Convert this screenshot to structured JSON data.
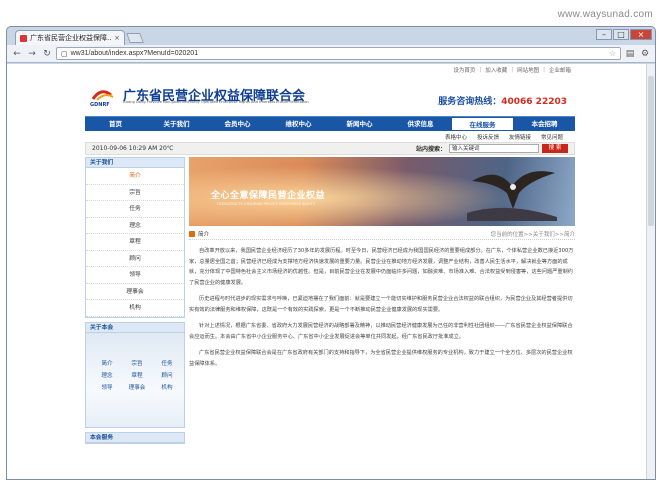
{
  "watermark": "www.waysunad.com",
  "browser": {
    "tab_title": "广东省民营企业权益保障...",
    "address": "ww31/about/index.aspx?MenuId=020201"
  },
  "top_links": [
    "设为首页",
    "加入收藏",
    "网站地图",
    "企业邮箱"
  ],
  "header": {
    "title": "广东省民营企业权益保障联合会",
    "en": "Guang Dong Province Non-governmentally Operated Enterprise Rights And Interests Ensure Federation",
    "hotline_label": "服务咨询热线：",
    "hotline": "40066 22203"
  },
  "nav": [
    "首页",
    "关于我们",
    "会员中心",
    "维权中心",
    "新闻中心",
    "供求信息",
    "在线服务",
    "本会招聘"
  ],
  "subnav": [
    "表格中心",
    "投诉反馈",
    "友情链接",
    "常见问题"
  ],
  "datebar": {
    "date": "2010-09-06 10:29 AM 20℃",
    "search_label": "站内搜索：",
    "search_value": "输入关键词",
    "search_btn": "搜 索"
  },
  "sidebar": {
    "about_title": "关于我们",
    "menu": [
      "简介",
      "宗旨",
      "任务",
      "理念",
      "章程",
      "顾问",
      "领导",
      "理事会",
      "机构"
    ],
    "assoc_title": "关于本会",
    "assoc_grid": [
      "简介",
      "宗旨",
      "任务",
      "理念",
      "章程",
      "顾问",
      "领导",
      "理事会",
      "机构"
    ],
    "service_title": "本会服务"
  },
  "banner": {
    "title": "全心全意保障民营企业权益",
    "sub": "DEDICATED TO ENSURING PRIVATE ENTERPRISE RIGHTS"
  },
  "crumb": {
    "title": "简介",
    "path": "您当前的位置>>关于我们>>简介"
  },
  "article": [
    "自改革开放以来，我国民营企业经济经历了30多年的发展历程。时至今日，民营经济已经成为我国国民经济的重要组成部分。在广东，个体私营企业数已接近300万家，总量居全国之首；民营经济已经成为支撑地方经济快速发展的重要力量。民营企业在推动地方经济发展，调整产业结构，改善人民生活水平，解决就业等方面的成就，充分体现了中国特色社会主义市场经济的优越性。但是，目前民营企业在发展中仍面临许多问题，如融资难、市场准入难、合法权益受到侵害等，这些问题严重制约了民营企业的健康发展。",
    "历史进程与时代进步的现实需求与呼唤，已紧迫地摆在了我们面前：就是要建立一个能切实维护和服务民营企业合法权益的联合组织，为民营企业及其经营者提供切实有效的法律服务和维权保障，这既是一个有效的实践探索，更是一个不断推动民营企业健康发展的现实需要。",
    "针对上述情况，根据广东省委、省政府大力发展民营经济的战略部署及精神，以推动民营经济健康发展为己任的非营利性社团组织——广东省民营企业权益保障联合会应运而生。本会由广东省中小企业服务中心、广东省中小企业发展促进会等单位共同发起，经广东省民政厅批准成立。",
    "广东省民营企业权益保障联合会是在广东省政府有关部门的支持和指导下，为全省民营企业提供维权服务的专业机构，致力于建立一个全方位、多层次的民营企业权益保障体系。"
  ]
}
